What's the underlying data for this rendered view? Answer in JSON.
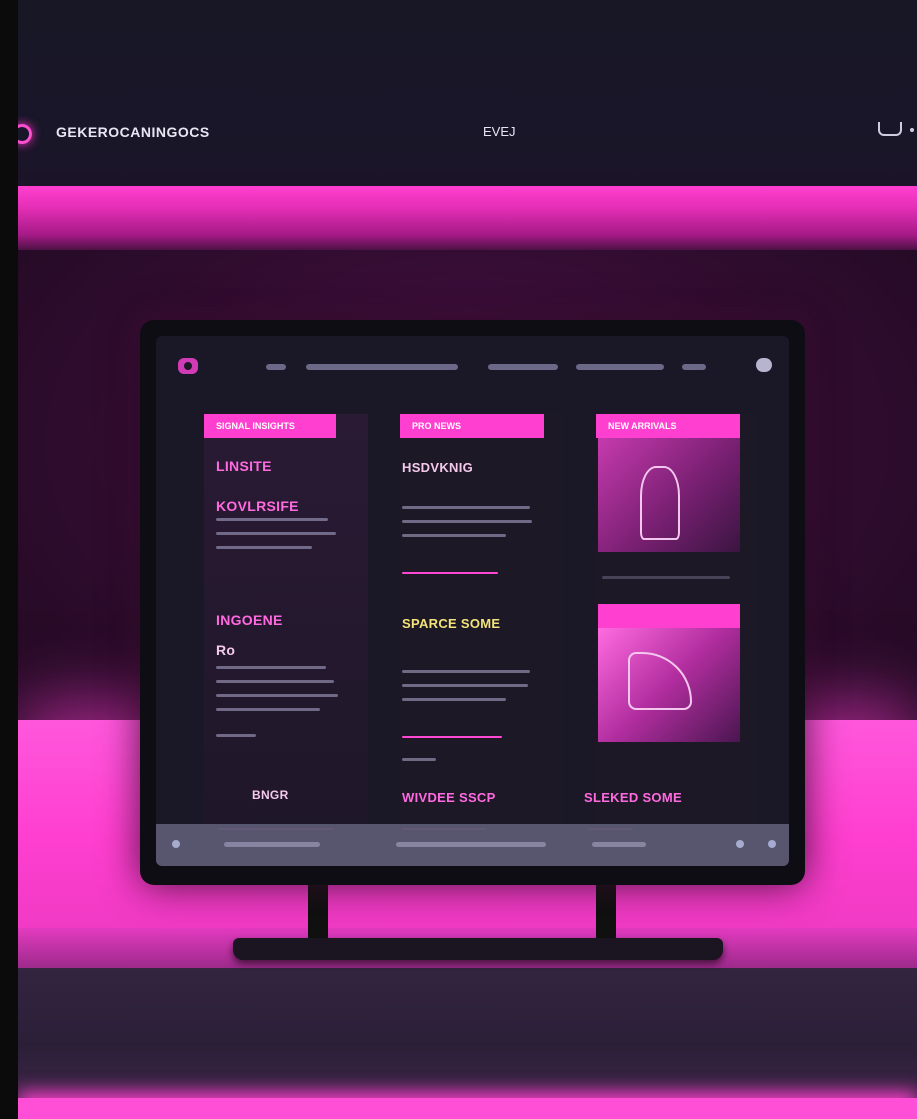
{
  "header": {
    "brand": "GEKEROCANINGOCS",
    "nav_link": "EVEJ"
  },
  "screen": {
    "columns": [
      {
        "tag": "SIGNAL INSIGHTS",
        "items": [
          {
            "heading": "LINSITE"
          },
          {
            "heading": "KOVLRSIFE"
          },
          {
            "heading": "INGOENE"
          },
          {
            "heading": "Ro"
          },
          {
            "heading": "BNGR"
          }
        ]
      },
      {
        "tag": "PRO NEWS",
        "items": [
          {
            "heading": "HSDVKNIG"
          },
          {
            "heading": "SPARCE SOME"
          },
          {
            "heading": "WIVDEE SSCP"
          }
        ]
      },
      {
        "tag": "NEW ARRIVALS",
        "items": [
          {
            "heading": "SLEKED SOME"
          }
        ]
      }
    ]
  }
}
